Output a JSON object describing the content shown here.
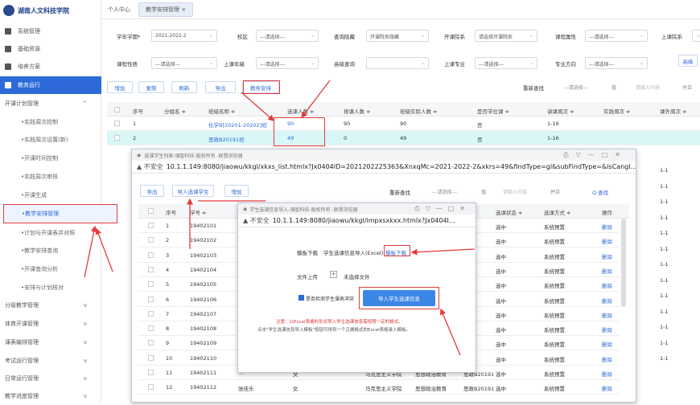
{
  "sidebar": {
    "school": "湖南人文科技学院",
    "items": [
      "系统管理",
      "基础资源",
      "培养方案",
      "教务运行"
    ],
    "group": "开课计划管理",
    "subs": [
      "实践周次控制",
      "实践周次设置(新)",
      "开课时间控制",
      "实践周次审核",
      "开课生成",
      "教学安排管理",
      "计划与开课表并对照",
      "教学安排查询",
      "开课查询分析",
      "安排与计划核对"
    ],
    "groups2": [
      "分级教学管理",
      "体育开课管理",
      "课表编排管理",
      "考试运行管理",
      "日常运行管理",
      "教学进度管理"
    ]
  },
  "tabs": {
    "home": "个人中心",
    "active": "教学安排管理 ×"
  },
  "filters": [
    {
      "label": "学年学期*",
      "value": "2021-2022-2"
    },
    {
      "label": "校区",
      "value": "---请选择---"
    },
    {
      "label": "查询隐藏",
      "value": "开课院系隐藏"
    },
    {
      "label": "开课院系",
      "value": "请选择开课院系"
    },
    {
      "label": "课程属性",
      "value": "---请选择---"
    },
    {
      "label": "上课院系",
      "value": ""
    },
    {
      "label": "课程性质",
      "value": "---请选择---"
    },
    {
      "label": "上课年级",
      "value": "---请选择---"
    },
    {
      "label": "高级查询",
      "value": ""
    },
    {
      "label": "上课专业",
      "value": "---请选择---"
    },
    {
      "label": "专业方向",
      "value": "---请选择---"
    },
    {
      "label": "高级",
      "value": ""
    }
  ],
  "toolbar": {
    "add": "增加",
    "copy": "复制",
    "refresh": "刷新",
    "export": "导出",
    "arrange": "教务安排",
    "regroup": "重新查找",
    "select": "---请选择---",
    "cond": "值",
    "input": "请输入内容",
    "ok": "并且"
  },
  "table": {
    "headers": [
      "序号",
      "分组名 ≑",
      "班级名称 ≑",
      "选课人数 ≑",
      "排课人数 ≑",
      "班级实际人数 ≑",
      "是否学位课 ≑",
      "讲课周次 ≑",
      "实践周次 ≑",
      "课外周次 ≑"
    ],
    "rows": [
      [
        "1",
        "",
        "化学B[20201-20202]班",
        "90",
        "90",
        "90",
        "否",
        "1-16",
        "",
        ""
      ],
      [
        "2",
        "",
        "思政B20191班",
        "49",
        "0",
        "49",
        "否",
        "1-16",
        "",
        ""
      ]
    ],
    "right_col": [
      "1-1",
      "1-1",
      "1-1",
      "1-1",
      "1-1",
      "1-1",
      "1-1",
      "1-1",
      "1-1",
      "1-1",
      "1-1",
      "1-1",
      "1-1"
    ]
  },
  "win1": {
    "title": "选课学生列表-强智科技-版权所有 -联想浏览器",
    "insecure": "▲ 不安全",
    "url": "10.1.1.149:8080/jiaowu/kkgl/xkxs_list.htmlx?Jx0404ID=2021202225363&XnxqMc=2021-2022-2&xkrs=49&findType=gl&subFindType=&isCangl...",
    "btns": {
      "export": "导出",
      "import": "导入选课学生",
      "add": "增加",
      "find": "重新查找",
      "select": "---请选择---",
      "cond": "值",
      "input": "请输入内容",
      "and": "并且",
      "search": "Q 查找"
    },
    "headers": [
      "序号",
      "学号 ≑",
      "选课状态 ≑",
      "选课方式 ≑",
      "操作"
    ],
    "rows": [
      [
        "1",
        "19402101"
      ],
      [
        "2",
        "19402102"
      ],
      [
        "3",
        "19402103"
      ],
      [
        "4",
        "19402104"
      ],
      [
        "5",
        "19402105"
      ],
      [
        "6",
        "19402106"
      ],
      [
        "7",
        "19402107"
      ],
      [
        "8",
        "19402108"
      ],
      [
        "9",
        "19402109"
      ],
      [
        "10",
        "19402110"
      ],
      [
        "11",
        "19402111"
      ],
      [
        "12",
        "19402112"
      ]
    ],
    "status": "选中",
    "method": "系统预置",
    "op": "删除",
    "extra11": [
      "…",
      "女",
      "马克思主义学院",
      "思想政治教育",
      "思政B20191"
    ],
    "extra12": [
      "张佳乐",
      "女",
      "马克思主义学院",
      "思想政治教育",
      "思政B20191"
    ]
  },
  "win2": {
    "title": "学生选课信息导入-强智科技-版权所有 -联想浏览器",
    "insecure": "▲ 不安全",
    "url": "10.1.1.149:8080/jiaowu/kkgl/impxsxkxx.htmlx?Jx0404I...",
    "tpl_label": "模板下载",
    "tpl_text": "学生选课信息导入(Excel)",
    "tpl_link": "模板下载",
    "upload_label": "文件上传",
    "upload_text": "未选择文件",
    "check_label": "是否检测学生课表冲突",
    "import_btn": "导入学生选课信息",
    "note1": "注意：以Excel表格的形式导入学生选课信息需按照一定的格式。",
    "note2": "点击\"学生选课信息导入模板\"按钮可得到一个正确格式的Excel表格录入模板。"
  }
}
